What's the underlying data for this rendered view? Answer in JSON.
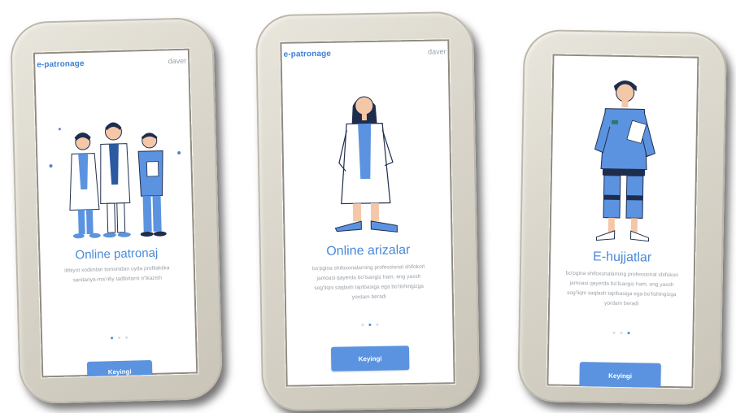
{
  "screens": [
    {
      "brand": "e-patronage",
      "status_right": "daver",
      "title": "Online patronaj",
      "desc_lines": [
        "ibbiyot xodimlari tomonidan uyda profilaktika",
        "sanitariya-maʼrifiy tadbirlarni oʻtkazish"
      ],
      "active_dot": 0,
      "button": "Keyingi",
      "illustration": "medical-team-illustration"
    },
    {
      "brand": "e-patronage",
      "status_right": "daver",
      "title": "Online arizalar",
      "desc_lines": [
        "bo'pgina shifoxonalarning professional shifokori",
        "jamoasi qayerda boʻlsangiz ham, eng yaxsh",
        "sogʻliqni saqlash tajribasiga ega boʻlishingizga",
        "yordam beradi"
      ],
      "active_dot": 1,
      "button": "Keyingi",
      "illustration": "female-doctor-illustration"
    },
    {
      "brand": "",
      "status_right": "",
      "title": "E-hujjatlar",
      "desc_lines": [
        "bo'pgina shifoxonalarning professional shifokori",
        "jamoasi qayerda boʻlsangiz ham, eng yaxsh",
        "sogʻliqni saqlash tajribasiga ega boʻlishingizga",
        "yordam beradi"
      ],
      "active_dot": 2,
      "button": "Keyingi",
      "illustration": "male-nurse-illustration"
    }
  ],
  "colors": {
    "accent": "#4a8ad8",
    "button": "#5b93e0",
    "bezel": "#d9d5ca"
  },
  "icons": [
    "medical-team-illustration",
    "female-doctor-illustration",
    "male-nurse-illustration"
  ]
}
